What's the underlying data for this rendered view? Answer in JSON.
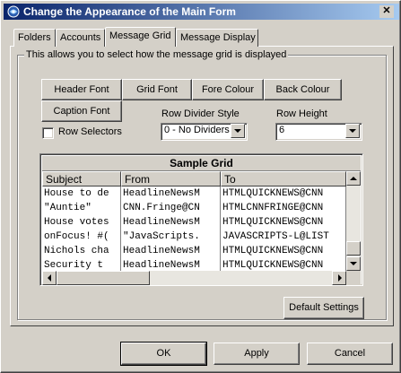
{
  "window": {
    "title": "Change the Appearance of the Main Form"
  },
  "tabs": [
    {
      "label": "Folders",
      "active": false
    },
    {
      "label": "Accounts",
      "active": false
    },
    {
      "label": "Message Grid",
      "active": true
    },
    {
      "label": "Message Display",
      "active": false
    }
  ],
  "group": {
    "caption": "This allows you to select how the message grid is displayed"
  },
  "buttons": {
    "header_font": "Header Font",
    "grid_font": "Grid Font",
    "fore_colour": "Fore Colour",
    "back_colour": "Back Colour",
    "caption_font": "Caption Font",
    "default_settings": "Default Settings",
    "ok": "OK",
    "apply": "Apply",
    "cancel": "Cancel"
  },
  "row_selectors": {
    "label": "Row Selectors",
    "checked": false
  },
  "row_divider_style": {
    "label": "Row Divider Style",
    "value": "0 - No Dividers"
  },
  "row_height": {
    "label": "Row Height",
    "value": "6"
  },
  "sample_grid": {
    "caption": "Sample Grid",
    "columns": [
      "Subject",
      "From",
      "To"
    ],
    "rows": [
      [
        "House to de",
        "HeadlineNewsM",
        "HTMLQUICKNEWS@CNN"
      ],
      [
        "\"Auntie\"",
        "CNN.Fringe@CN",
        "HTMLCNNFRINGE@CNN"
      ],
      [
        "House votes",
        "HeadlineNewsM",
        "HTMLQUICKNEWS@CNN"
      ],
      [
        "onFocus! #(",
        "\"JavaScripts.",
        "JAVASCRIPTS-L@LIST"
      ],
      [
        "Nichols cha",
        "HeadlineNewsM",
        "HTMLQUICKNEWS@CNN"
      ],
      [
        "Security t",
        "HeadlineNewsM",
        "HTMLQUICKNEWS@CNN"
      ]
    ]
  }
}
